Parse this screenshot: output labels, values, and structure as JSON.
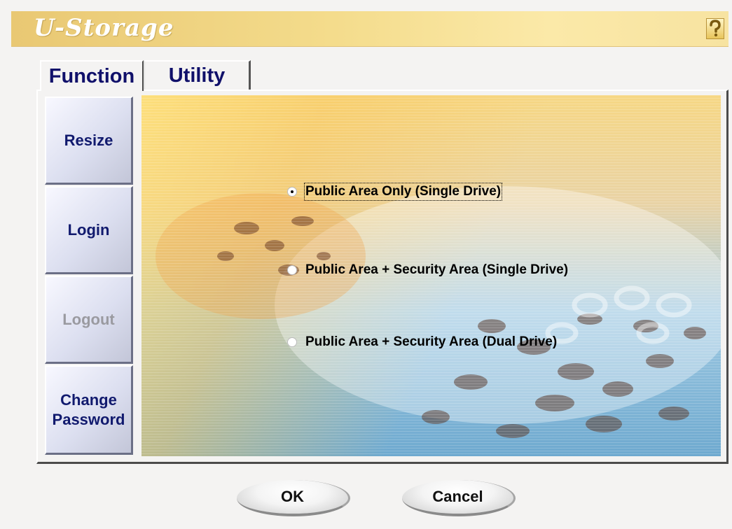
{
  "app": {
    "title": "U-Storage",
    "help_icon": "question-mark-icon"
  },
  "tabs": [
    {
      "label": "Function",
      "active": true
    },
    {
      "label": "Utility",
      "active": false
    }
  ],
  "sidebar": {
    "buttons": [
      {
        "label": "Resize",
        "enabled": true
      },
      {
        "label": "Login",
        "enabled": true
      },
      {
        "label": "Logout",
        "enabled": false
      },
      {
        "label": "Change Password",
        "enabled": true
      }
    ]
  },
  "options": [
    {
      "label": "Public Area Only (Single Drive)",
      "selected": true
    },
    {
      "label": "Public Area + Security Area (Single Drive)",
      "selected": false
    },
    {
      "label": "Public Area + Security Area (Dual Drive)",
      "selected": false
    }
  ],
  "footer": {
    "ok_label": "OK",
    "cancel_label": "Cancel"
  },
  "colors": {
    "title_bar": "#f4dc8c",
    "tab_text": "#10106a",
    "button_text": "#111a6e",
    "disabled_text": "#9a9aa0"
  }
}
